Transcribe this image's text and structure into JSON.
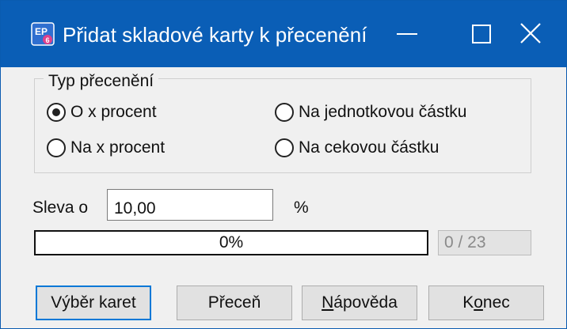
{
  "window": {
    "title": "Přidat skladové karty k přecenění",
    "icon": "app-ep-icon",
    "controls": [
      "minimize-icon",
      "maximize-icon",
      "close-icon"
    ]
  },
  "group": {
    "title": "Typ přecenění",
    "options": [
      {
        "label": "O x procent",
        "checked": true
      },
      {
        "label": "Na jednotkovou částku",
        "checked": false
      },
      {
        "label": "Na x procent",
        "checked": false
      },
      {
        "label": "Na cekovou částku",
        "checked": false
      }
    ]
  },
  "discount": {
    "label": "Sleva o",
    "value": "10,00",
    "unit": "%"
  },
  "progress": {
    "percent_text": "0%",
    "fraction": 0,
    "counter": "0 / 23"
  },
  "buttons": {
    "select_cards": "Výběr karet",
    "reprice": "Přeceň",
    "help": {
      "underlined": "N",
      "rest": "ápověda"
    },
    "end": {
      "first": "K",
      "underlined": "o",
      "rest": "nec"
    }
  },
  "colors": {
    "titlebar": "#0a5eb6",
    "progress_fill": "#06b025",
    "focus_border": "#0078d7"
  }
}
